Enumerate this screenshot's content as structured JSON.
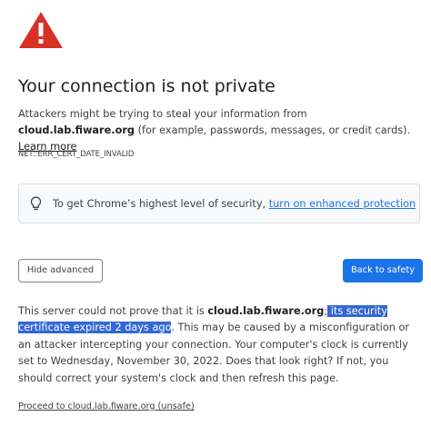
{
  "icons": {
    "warning": "warning-triangle-icon",
    "bulb": "lightbulb-icon"
  },
  "colors": {
    "warning_red": "#d93025",
    "accent_blue": "#1a73e8",
    "selection_blue": "#3367d6"
  },
  "title": "Your connection is not private",
  "intro": {
    "before": "Attackers might be trying to steal your information from ",
    "host": "cloud.lab.fiware.org",
    "after": " (for example, passwords, messages, or credit cards). ",
    "learn_more": "Learn more"
  },
  "error_code": "NET::ERR_CERT_DATE_INVALID",
  "callout": {
    "text": "To get Chrome’s highest level of security, ",
    "link": "turn on enhanced protection"
  },
  "buttons": {
    "hide_advanced": "Hide advanced",
    "back_to_safety": "Back to safety"
  },
  "details": {
    "before": "This server could not prove that it is ",
    "host": "cloud.lab.fiware.org",
    "semicolon": ";",
    "highlighted": " its security certificate expired 2 days ago",
    "after": ". This may be caused by a misconfiguration or an attacker intercepting your connection. Your computer's clock is currently set to Wednesday, November 30, 2022. Does that look right? If not, you should correct your system's clock and then refresh this page."
  },
  "proceed_link": "Proceed to cloud.lab.fiware.org (unsafe)"
}
